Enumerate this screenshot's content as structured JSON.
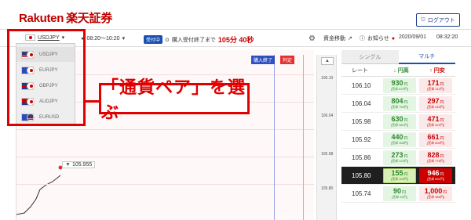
{
  "header": {
    "logo_text": "Rakuten",
    "logo_jp": "楽天証券",
    "logout_label": "ログアウト",
    "logout_icon": "logout-icon"
  },
  "toolbar": {
    "pair": "USDJPY",
    "time_range": "08:20〜10:20",
    "status_badge": "受付中",
    "order_until_label": "購入受付終了まで",
    "countdown": "105分 40秒",
    "deposit_label": "資金移動",
    "notice_label": "お知らせ",
    "date": "2020/09/01",
    "clock": "08:32:20"
  },
  "dropdown": {
    "items": [
      "USDJPY",
      "EURJPY",
      "GBPJPY",
      "AUDJPY",
      "EURUSD"
    ]
  },
  "callout": {
    "text": "「通貨ペア」を選ぶ"
  },
  "chart": {
    "tag_end": "購入終了",
    "tag_fix": "判定",
    "current_price": "105.955",
    "y_ticks": [
      "106.10",
      "106.04",
      "105.98",
      "105.92",
      "105.86",
      "105.80"
    ]
  },
  "panel": {
    "tabs": [
      "シングル",
      "マルチ"
    ],
    "headers": {
      "rate": "レート",
      "buy": "円高",
      "sell": "円安"
    },
    "rows": [
      {
        "rate": "106.10",
        "buy": "930",
        "buy_sub": "(売却 870円)",
        "sell": "171",
        "sell_sub": "(売却 111円)"
      },
      {
        "rate": "106.04",
        "buy": "804",
        "buy_sub": "(売却 753円)",
        "sell": "297",
        "sell_sub": "(売却 240円)"
      },
      {
        "rate": "105.98",
        "buy": "630",
        "buy_sub": "(売却 581円)",
        "sell": "471",
        "sell_sub": "(売却 421円)"
      },
      {
        "rate": "105.92",
        "buy": "440",
        "buy_sub": "(売却 398円)",
        "sell": "661",
        "sell_sub": "(売却 600円)"
      },
      {
        "rate": "105.86",
        "buy": "273",
        "buy_sub": "(売却 223円)",
        "sell": "828",
        "sell_sub": "(売却 776円)"
      },
      {
        "rate": "105.80",
        "buy": "155",
        "buy_sub": "(売却 109円)",
        "sell": "946",
        "sell_sub": "(売却 891円)"
      },
      {
        "rate": "105.74",
        "buy": "90",
        "buy_sub": "(売却 44円)",
        "sell": "1,000",
        "sell_sub": "(売却 956円)"
      }
    ],
    "unit": "円"
  }
}
